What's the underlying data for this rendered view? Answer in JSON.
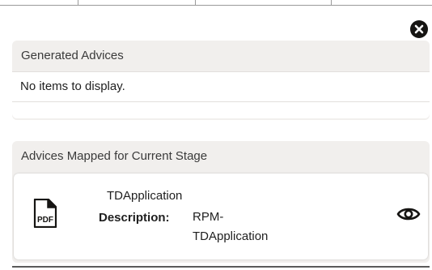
{
  "generated_advices": {
    "header": "Generated Advices",
    "empty_message": "No items to display."
  },
  "mapped_advices": {
    "header": "Advices Mapped for Current Stage",
    "items": [
      {
        "icon": "pdf-icon",
        "name": "TDApplication",
        "description_label": "Description:",
        "description_line1": "RPM-",
        "description_line2": "TDApplication",
        "action_icon": "eye-icon"
      }
    ]
  },
  "close_icon": "close-icon",
  "icon_pdf_text": "PDF"
}
